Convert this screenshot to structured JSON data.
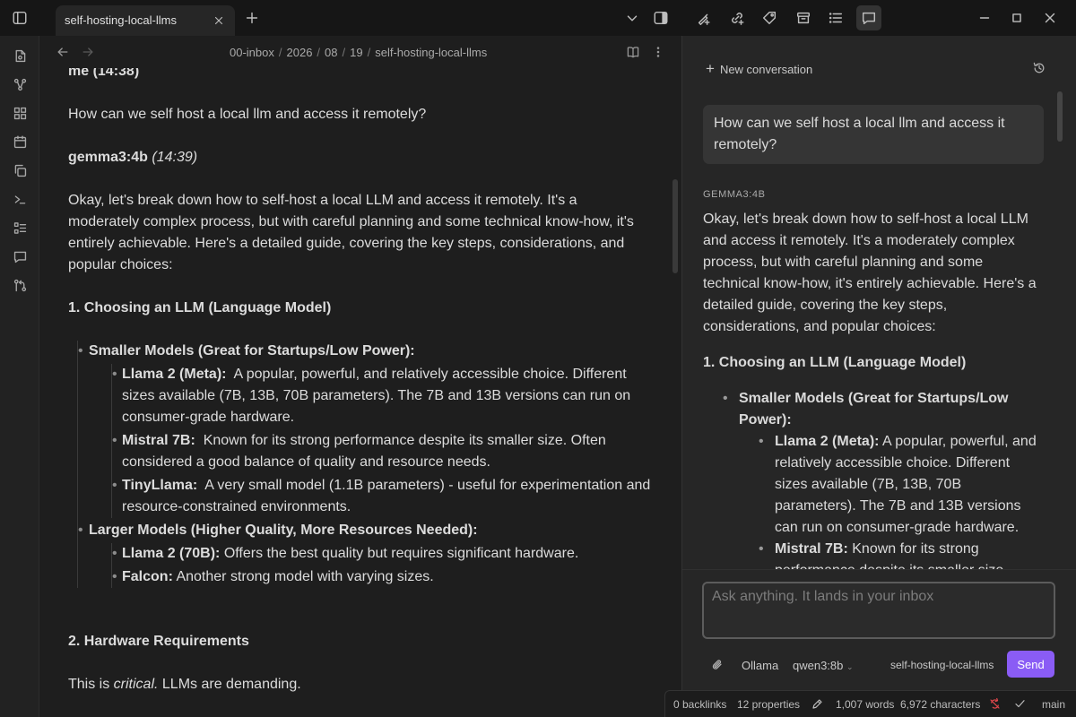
{
  "tab": {
    "title": "self-hosting-local-llms"
  },
  "breadcrumb": [
    "00-inbox",
    "2026",
    "08",
    "19",
    "self-hosting-local-llms"
  ],
  "note": {
    "top_cut": "me (14:38)",
    "question": "How can we self host a local llm and access it remotely?",
    "responder_name": "gemma3:4b",
    "responder_time": "(14:39)",
    "intro": "Okay, let's break down how to self-host a local LLM and access it remotely. It's a moderately complex process, but with careful planning and some technical know-how, it's entirely achievable. Here's a detailed guide, covering the key steps, considerations, and popular choices:",
    "section1": "1. Choosing an LLM (Language Model)",
    "smaller_models": "Smaller Models (Great for Startups/Low Power):",
    "llama2_label": "Llama 2 (Meta):",
    "llama2_text": "A popular, powerful, and relatively accessible choice. Different sizes available (7B, 13B, 70B parameters). The 7B and 13B versions can run on consumer-grade hardware.",
    "mistral_label": "Mistral 7B:",
    "mistral_text": "Known for its strong performance despite its smaller size.  Often considered a good balance of quality and resource needs.",
    "tinyllama_label": "TinyLlama:",
    "tinyllama_text": "A very small model (1.1B parameters) - useful for experimentation and resource-constrained environments.",
    "larger_models": "Larger Models (Higher Quality, More Resources Needed):",
    "llama70_label": "Llama 2 (70B):",
    "llama70_text": "Offers the best quality but requires significant hardware.",
    "falcon_label": "Falcon:",
    "falcon_text": "Another strong model with varying sizes.",
    "section2": "2. Hardware Requirements",
    "critical_pre": "This is ",
    "critical_em": "critical.",
    "critical_post": " LLMs are demanding."
  },
  "chat": {
    "new_conversation": "New conversation",
    "user_message": "How can we self host a local llm and access it remotely?",
    "assistant_name": "GEMMA3:4B",
    "assistant_intro": "Okay, let's break down how to self-host a local LLM and access it remotely. It's a moderately complex process, but with careful planning and some technical know-how, it's entirely achievable. Here's a detailed guide, covering the key steps, considerations, and popular choices:",
    "section1": "1. Choosing an LLM (Language Model)",
    "smaller_models": "Smaller Models (Great for Startups/Low Power):",
    "llama2_label": "Llama 2 (Meta):",
    "llama2_text": " A popular, powerful, and relatively accessible choice. Different sizes available (7B, 13B, 70B parameters). The 7B and 13B versions can run on consumer-grade hardware.",
    "mistral_label": "Mistral 7B:",
    "mistral_text": " Known for its strong performance despite its smaller size. Often considered a good balance of quality and resource needs.",
    "input_placeholder": "Ask anything. It lands in your inbox",
    "provider": "Ollama",
    "model": "qwen3:8b",
    "context_note": "self-hosting-local-llms",
    "send_label": "Send"
  },
  "status": {
    "backlinks": "0 backlinks",
    "properties": "12 properties",
    "words": "1,007 words",
    "characters": "6,972 characters",
    "branch": "main"
  },
  "colors": {
    "accent": "#8a5cf5",
    "sync_error": "#e5484d"
  }
}
